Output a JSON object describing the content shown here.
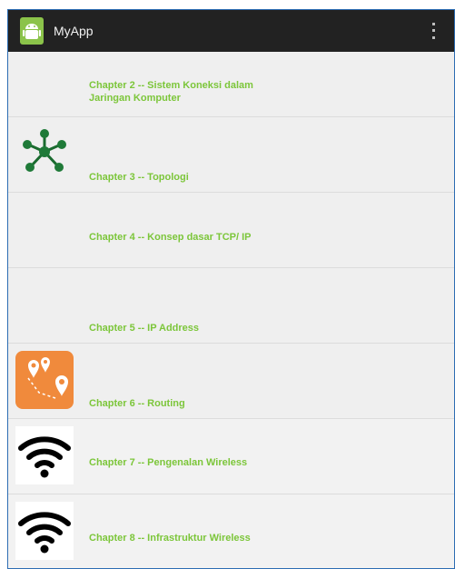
{
  "app": {
    "title": "MyApp",
    "icon": "android-icon"
  },
  "actionbar": {
    "overflow_icon": "overflow-menu-icon"
  },
  "chapters": [
    {
      "label": "Chapter 2 -- Sistem Koneksi dalam Jaringan Komputer",
      "icon": null
    },
    {
      "label": "Chapter 3 -- Topologi",
      "icon": "network-topology-icon"
    },
    {
      "label": "Chapter 4 -- Konsep dasar TCP/ IP",
      "icon": null
    },
    {
      "label": "Chapter 5 -- IP Address",
      "icon": null
    },
    {
      "label": "Chapter 6 -- Routing",
      "icon": "map-pins-icon"
    },
    {
      "label": "Chapter 7 -- Pengenalan Wireless",
      "icon": "wifi-icon"
    },
    {
      "label": "Chapter 8 -- Infrastruktur Wireless",
      "icon": "wifi-icon"
    }
  ],
  "colors": {
    "actionbar": "#222222",
    "label_green": "#7cc63a",
    "list_bg": "#efefef",
    "routing_orange": "#f08a3c"
  }
}
